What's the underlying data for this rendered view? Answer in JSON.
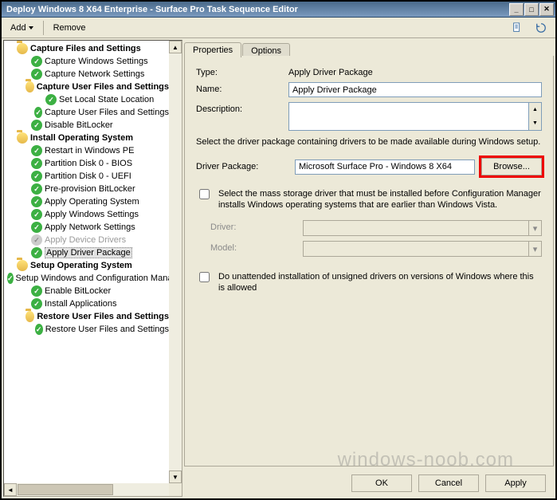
{
  "window": {
    "title": "Deploy Windows 8 X64 Enterprise - Surface Pro Task Sequence Editor"
  },
  "toolbar": {
    "add": "Add",
    "remove": "Remove"
  },
  "tree": {
    "items": [
      {
        "depth": 0,
        "icon": "folder",
        "bold": true,
        "label": "Capture Files and Settings"
      },
      {
        "depth": 1,
        "icon": "check",
        "label": "Capture Windows Settings"
      },
      {
        "depth": 1,
        "icon": "check",
        "label": "Capture Network Settings"
      },
      {
        "depth": 1,
        "icon": "folder",
        "bold": true,
        "label": "Capture User Files and Settings"
      },
      {
        "depth": 2,
        "icon": "check",
        "label": "Set Local State Location"
      },
      {
        "depth": 2,
        "icon": "check",
        "label": "Capture User Files and Settings"
      },
      {
        "depth": 1,
        "icon": "check",
        "label": "Disable BitLocker"
      },
      {
        "depth": 0,
        "icon": "folder",
        "bold": true,
        "label": "Install Operating System"
      },
      {
        "depth": 1,
        "icon": "check",
        "label": "Restart in Windows PE"
      },
      {
        "depth": 1,
        "icon": "check",
        "label": "Partition Disk 0 - BIOS"
      },
      {
        "depth": 1,
        "icon": "check",
        "label": "Partition Disk 0 - UEFI"
      },
      {
        "depth": 1,
        "icon": "check",
        "label": "Pre-provision BitLocker"
      },
      {
        "depth": 1,
        "icon": "check",
        "label": "Apply Operating System"
      },
      {
        "depth": 1,
        "icon": "check",
        "label": "Apply Windows Settings"
      },
      {
        "depth": 1,
        "icon": "check",
        "label": "Apply Network Settings"
      },
      {
        "depth": 1,
        "icon": "disabled",
        "label": "Apply Device Drivers",
        "grey": true
      },
      {
        "depth": 1,
        "icon": "check",
        "label": "Apply Driver Package",
        "selected": true
      },
      {
        "depth": 0,
        "icon": "folder",
        "bold": true,
        "label": "Setup Operating System"
      },
      {
        "depth": 1,
        "icon": "check",
        "label": "Setup Windows and Configuration Manager"
      },
      {
        "depth": 1,
        "icon": "check",
        "label": "Enable BitLocker"
      },
      {
        "depth": 1,
        "icon": "check",
        "label": "Install Applications"
      },
      {
        "depth": 1,
        "icon": "folder",
        "bold": true,
        "label": "Restore User Files and Settings"
      },
      {
        "depth": 2,
        "icon": "check",
        "label": "Restore User Files and Settings"
      }
    ]
  },
  "tabs": {
    "properties": "Properties",
    "options": "Options"
  },
  "form": {
    "type_label": "Type:",
    "type_value": "Apply Driver Package",
    "name_label": "Name:",
    "name_value": "Apply Driver Package",
    "desc_label": "Description:",
    "section_text": "Select the driver package containing drivers to be made available during Windows setup.",
    "pkg_label": "Driver Package:",
    "pkg_value": "Microsoft Surface Pro - Windows 8 X64",
    "browse": "Browse...",
    "mass_storage_text": "Select the mass storage driver that must be installed before Configuration Manager installs Windows operating systems that are earlier than Windows Vista.",
    "driver_label": "Driver:",
    "model_label": "Model:",
    "unattended_text": "Do unattended installation of unsigned drivers on versions of Windows where this is allowed"
  },
  "buttons": {
    "ok": "OK",
    "cancel": "Cancel",
    "apply": "Apply"
  },
  "watermark": "windows-noob.com"
}
